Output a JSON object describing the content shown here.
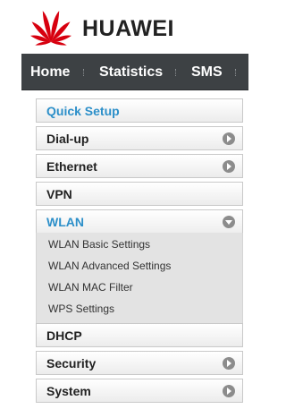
{
  "brand": {
    "name": "HUAWEI",
    "logo_color": "#d7000f"
  },
  "nav": {
    "items": [
      "Home",
      "Statistics",
      "SMS"
    ]
  },
  "sidebar": {
    "items": [
      {
        "label": "Quick Setup",
        "arrow": "none",
        "color": "#2c8fc9"
      },
      {
        "label": "Dial-up",
        "arrow": "right"
      },
      {
        "label": "Ethernet",
        "arrow": "right"
      },
      {
        "label": "VPN",
        "arrow": "none"
      },
      {
        "label": "WLAN",
        "arrow": "down",
        "color": "#2c8fc9",
        "expanded": true
      },
      {
        "label": "DHCP",
        "arrow": "none"
      },
      {
        "label": "Security",
        "arrow": "right"
      },
      {
        "label": "System",
        "arrow": "right"
      }
    ],
    "wlan_submenu": [
      "WLAN Basic Settings",
      "WLAN Advanced Settings",
      "WLAN MAC Filter",
      "WPS Settings"
    ]
  }
}
